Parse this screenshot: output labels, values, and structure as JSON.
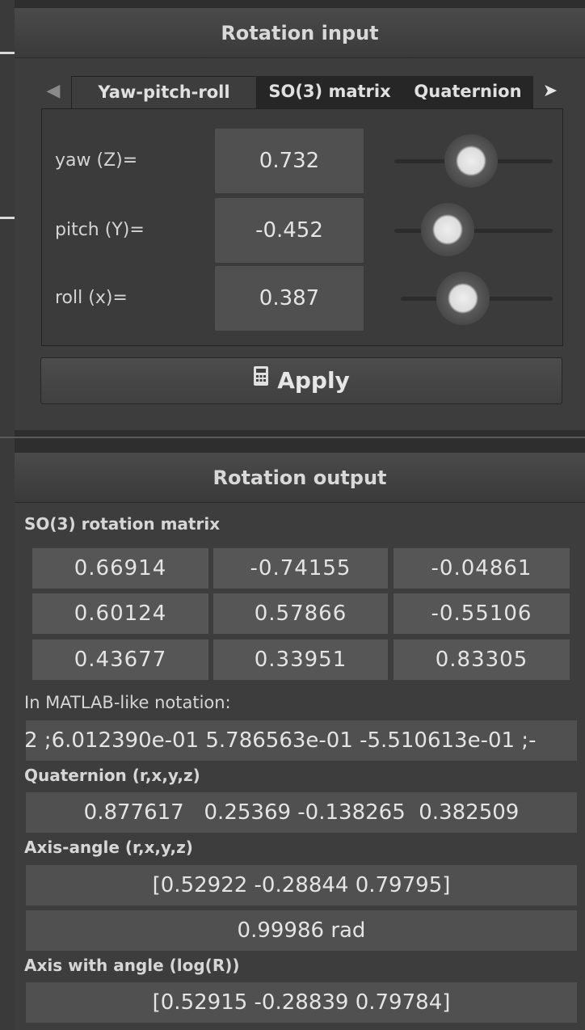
{
  "input_panel": {
    "title": "Rotation input",
    "tabs": [
      {
        "label": "Yaw-pitch-roll",
        "active": true
      },
      {
        "label": "SO(3) matrix",
        "active": false
      },
      {
        "label": "Quaternion",
        "active": false
      }
    ],
    "rows": {
      "yaw": {
        "label": "yaw (Z)=",
        "value": "0.732"
      },
      "pitch": {
        "label": "pitch (Y)=",
        "value": "-0.452"
      },
      "roll": {
        "label": "roll (x)=",
        "value": "0.387"
      }
    },
    "apply_label": "Apply"
  },
  "output_panel": {
    "title": "Rotation output",
    "so3_label": "SO(3) rotation matrix",
    "matrix": [
      [
        "0.66914",
        "-0.74155",
        "-0.04861"
      ],
      [
        "0.60124",
        "0.57866",
        "-0.55106"
      ],
      [
        "0.43677",
        "0.33951",
        "0.83305"
      ]
    ],
    "matlab_label": "In MATLAB-like notation:",
    "matlab_value": "2 ;6.012390e-01 5.786563e-01 -5.510613e-01 ;-",
    "quaternion_label": "Quaternion (r,x,y,z)",
    "quaternion_value": "0.877617   0.25369 -0.138265  0.382509",
    "axis_angle_label": "Axis-angle (r,x,y,z)",
    "axis_value": "[0.52922 -0.28844 0.79795]",
    "angle_value": "0.99986 rad",
    "axis_with_angle_label": "Axis with angle (log(R))",
    "axis_with_angle_value": "[0.52915 -0.28839 0.79784]"
  },
  "icons": {
    "tab_left": "arrow-left-icon",
    "tab_right": "arrow-right-icon",
    "apply": "calculator-icon"
  }
}
